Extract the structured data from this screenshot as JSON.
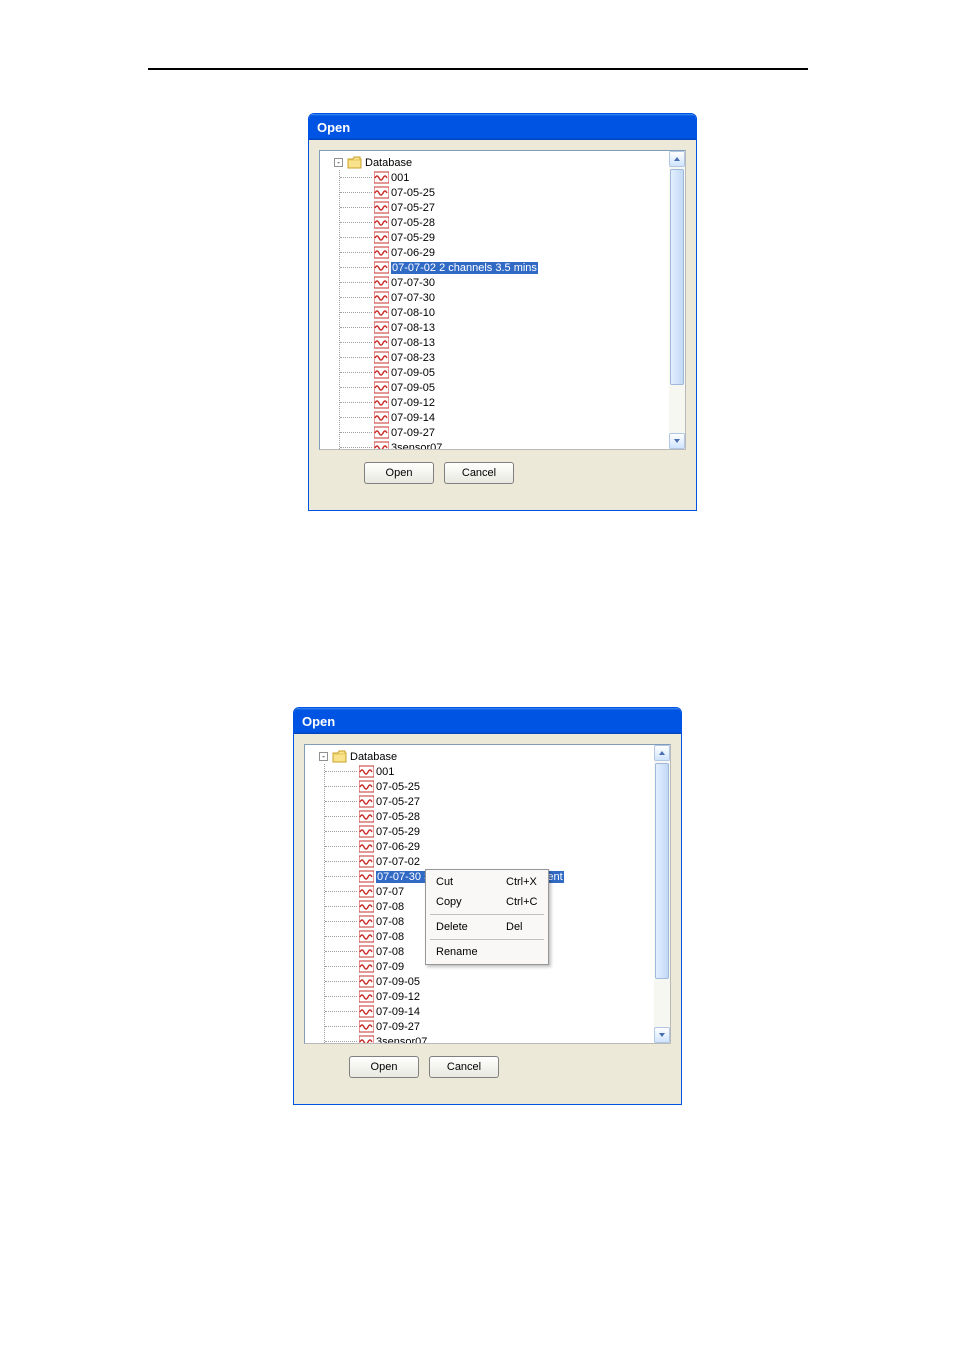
{
  "dialog1": {
    "title": "Open",
    "root": "Database",
    "expander": "-",
    "selected_index": 6,
    "items": [
      "001",
      "07-05-25",
      "07-05-27",
      "07-05-28",
      "07-05-29",
      "07-06-29",
      "07-07-02 2 channels 3.5 mins",
      "07-07-30",
      "07-07-30",
      "07-08-10",
      "07-08-13",
      "07-08-13",
      "07-08-23",
      "07-09-05",
      "07-09-05",
      "07-09-12",
      "07-09-14",
      "07-09-27",
      "3sensor07"
    ],
    "buttons": {
      "open": "Open",
      "cancel": "Cancel"
    }
  },
  "dialog2": {
    "title": "Open",
    "root": "Database",
    "expander": "-",
    "selected_index": 7,
    "items": [
      "001",
      "07-05-25",
      "07-05-27",
      "07-05-28",
      "07-05-29",
      "07-06-29",
      "07-07-02",
      "07-07-30 3 channels 3 cycles different",
      "07-07",
      "07-08",
      "07-08",
      "07-08",
      "07-08",
      "07-09",
      "07-09-05",
      "07-09-12",
      "07-09-14",
      "07-09-27",
      "3sensor07"
    ],
    "buttons": {
      "open": "Open",
      "cancel": "Cancel"
    },
    "context_menu": {
      "cut": {
        "label": "Cut",
        "shortcut": "Ctrl+X"
      },
      "copy": {
        "label": "Copy",
        "shortcut": "Ctrl+C"
      },
      "delete": {
        "label": "Delete",
        "shortcut": "Del"
      },
      "rename": {
        "label": "Rename",
        "shortcut": ""
      }
    }
  },
  "icons": {
    "up": "up-arrow-icon",
    "down": "down-arrow-icon",
    "folder": "folder-open-icon",
    "file": "signal-file-icon"
  }
}
